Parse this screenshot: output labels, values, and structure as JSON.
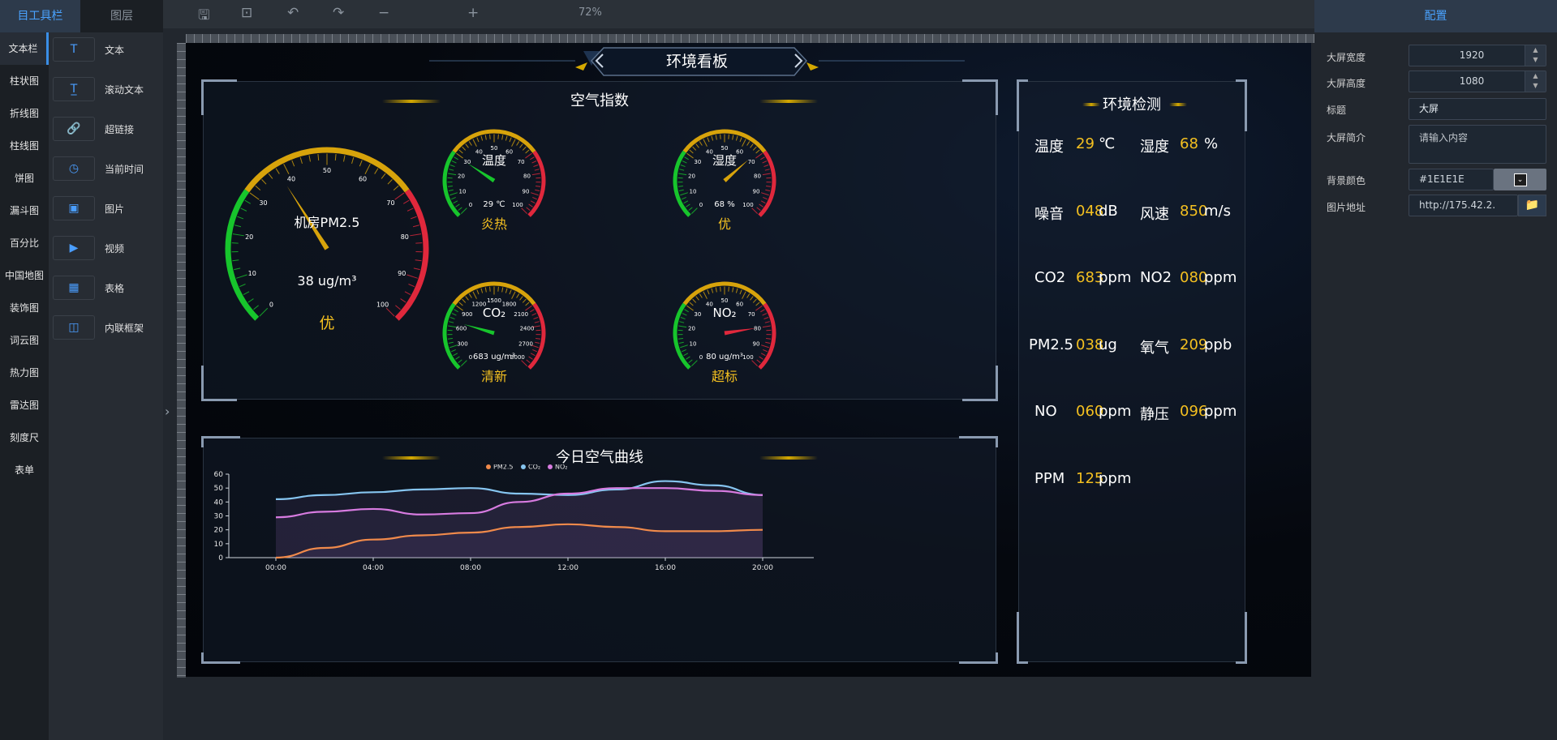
{
  "left_tabs": {
    "tools": "目工具栏",
    "layers": "图层"
  },
  "categories": [
    "文本栏",
    "柱状图",
    "折线图",
    "柱线图",
    "饼图",
    "漏斗图",
    "百分比",
    "中国地图",
    "装饰图",
    "词云图",
    "热力图",
    "雷达图",
    "刻度尺",
    "表单"
  ],
  "widgets": [
    {
      "label": "文本",
      "icon": "T"
    },
    {
      "label": "滚动文本",
      "icon": "T̲"
    },
    {
      "label": "超链接",
      "icon": "🔗"
    },
    {
      "label": "当前时间",
      "icon": "◷"
    },
    {
      "label": "图片",
      "icon": "▣"
    },
    {
      "label": "视频",
      "icon": "▶"
    },
    {
      "label": "表格",
      "icon": "▦"
    },
    {
      "label": "内联框架",
      "icon": "◫"
    }
  ],
  "toolbar": {
    "zoom": "72%"
  },
  "right_panel": {
    "header": "配置",
    "fields": [
      {
        "label": "大屏宽度",
        "value": "1920"
      },
      {
        "label": "大屏高度",
        "value": "1080"
      },
      {
        "label": "标题",
        "value": "大屏"
      },
      {
        "label": "大屏简介",
        "value": "请输入内容"
      },
      {
        "label": "背景颜色",
        "value": "#1E1E1E"
      },
      {
        "label": "图片地址",
        "value": "http://175.42.2."
      }
    ]
  },
  "dashboard": {
    "title": "环境看板",
    "air_panel_title": "空气指数",
    "env_panel_title": "环境检测",
    "curve_panel_title": "今日空气曲线"
  },
  "gauges": [
    {
      "name": "机房PM2.5",
      "value_text": "38 ug/m³",
      "status": "优",
      "value": 38,
      "min": 0,
      "max": 100,
      "ticks": [
        "0",
        "10",
        "20",
        "30",
        "40",
        "50",
        "60",
        "70",
        "80",
        "90",
        "100"
      ]
    },
    {
      "name": "温度",
      "value_text": "29 ℃",
      "status": "炎热",
      "value": 29,
      "min": 0,
      "max": 100,
      "ticks": [
        "0",
        "10",
        "20",
        "30",
        "40",
        "50",
        "60",
        "70",
        "80",
        "90",
        "100"
      ]
    },
    {
      "name": "湿度",
      "value_text": "68 %",
      "status": "优",
      "value": 68,
      "min": 0,
      "max": 100,
      "ticks": [
        "0",
        "10",
        "20",
        "30",
        "40",
        "50",
        "60",
        "70",
        "80",
        "90",
        "100"
      ]
    },
    {
      "name": "CO₂",
      "value_text": "683 ug/m³",
      "status": "清新",
      "value": 683,
      "min": 0,
      "max": 3000,
      "ticks": [
        "0",
        "300",
        "600",
        "900",
        "1200",
        "1500",
        "1800",
        "2100",
        "2400",
        "2700",
        "3000"
      ]
    },
    {
      "name": "NO₂",
      "value_text": "80 ug/m³",
      "status": "超标",
      "value": 80,
      "min": 0,
      "max": 100,
      "ticks": [
        "0",
        "10",
        "20",
        "30",
        "40",
        "50",
        "60",
        "70",
        "80",
        "90",
        "100"
      ]
    }
  ],
  "env_readings": [
    {
      "label": "温度",
      "value": "29",
      "unit": "℃"
    },
    {
      "label": "湿度",
      "value": "68",
      "unit": "%"
    },
    {
      "label": "噪音",
      "value": "048",
      "unit": "dB"
    },
    {
      "label": "风速",
      "value": "850",
      "unit": "m/s"
    },
    {
      "label": "CO2",
      "value": "683",
      "unit": "ppm"
    },
    {
      "label": "NO2",
      "value": "080",
      "unit": "ppm"
    },
    {
      "label": "PM2.5",
      "value": "038",
      "unit": "ug"
    },
    {
      "label": "氧气",
      "value": "209",
      "unit": "ppb"
    },
    {
      "label": "NO",
      "value": "060",
      "unit": "ppm"
    },
    {
      "label": "静压",
      "value": "096",
      "unit": "ppm"
    },
    {
      "label": "PPM",
      "value": "125",
      "unit": "ppm"
    }
  ],
  "colors": {
    "accent": "#3a8ee6",
    "value_yellow": "#f4c020",
    "pm25": "#f08a4b",
    "co2": "#86c5f0",
    "no2": "#d77be0"
  },
  "chart_data": {
    "type": "line",
    "title": "今日空气曲线",
    "x": [
      "00:00",
      "02:00",
      "04:00",
      "06:00",
      "08:00",
      "10:00",
      "12:00",
      "14:00",
      "16:00",
      "18:00",
      "20:00"
    ],
    "x_tick_labels": [
      "00:00",
      "04:00",
      "08:00",
      "12:00",
      "16:00",
      "20:00"
    ],
    "ylim": [
      0,
      60
    ],
    "y_ticks": [
      "0",
      "10",
      "20",
      "30",
      "40",
      "50",
      "60"
    ],
    "legend": "top-center",
    "series": [
      {
        "name": "PM2.5",
        "color": "#f08a4b",
        "values": [
          0,
          7,
          13,
          16,
          18,
          22,
          24,
          22,
          19,
          19,
          20
        ]
      },
      {
        "name": "CO₂",
        "color": "#86c5f0",
        "values": [
          42,
          45,
          47,
          49,
          50,
          46,
          45,
          49,
          55,
          52,
          45
        ]
      },
      {
        "name": "NO₂",
        "color": "#d77be0",
        "values": [
          29,
          33,
          35,
          31,
          32,
          40,
          46,
          50,
          50,
          48,
          45
        ]
      }
    ]
  }
}
